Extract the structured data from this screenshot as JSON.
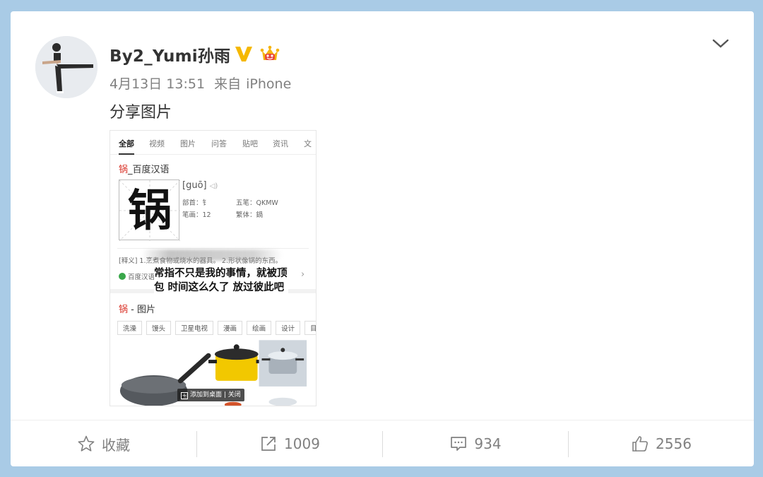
{
  "post": {
    "username": "By2_Yumi孙雨",
    "date": "4月13日 13:51",
    "source_prefix": "来自",
    "source": "iPhone",
    "text": "分享图片"
  },
  "shared_image": {
    "tabs": [
      "全部",
      "视频",
      "图片",
      "问答",
      "贴吧",
      "资讯",
      "文"
    ],
    "dict_title_char": "锅",
    "dict_title_rest": "_百度汉语",
    "character": "锅",
    "pinyin": "[guō]",
    "radical": "部首：钅",
    "wubi": "五笔：QKMW",
    "strokes": "笔画：12",
    "traditional": "繁体：鍋",
    "definition": "[释义] 1.烹煮食物或烧水的器具。 2.形状像锅的东西。",
    "source_label": "百度汉语",
    "overlay_text": "常指不只是我的事情，就被顶包 时间这么久了 放过彼此吧",
    "images_title_char": "锅",
    "images_title_rest": " - 图片",
    "tags": [
      "洗澡",
      "馒头",
      "卫星电视",
      "漫画",
      "绘画",
      "设计",
      "目"
    ],
    "add_to_desktop": "添加到桌面 | 关闭"
  },
  "footer": {
    "favorite_label": "收藏",
    "repost_count": "1009",
    "comment_count": "934",
    "like_count": "2556"
  },
  "colors": {
    "page_background": "#a9cbe6",
    "verified_gold": "#f5b800",
    "accent_red": "#d93025"
  }
}
